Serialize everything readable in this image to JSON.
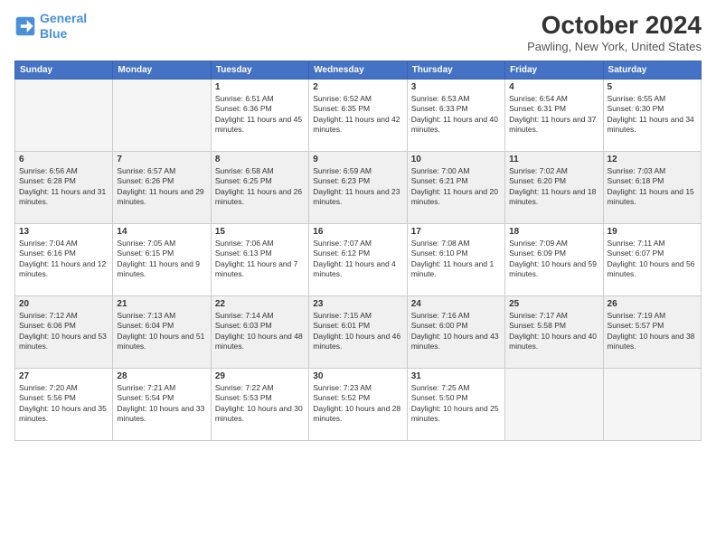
{
  "header": {
    "logo_line1": "General",
    "logo_line2": "Blue",
    "month_year": "October 2024",
    "location": "Pawling, New York, United States"
  },
  "weekdays": [
    "Sunday",
    "Monday",
    "Tuesday",
    "Wednesday",
    "Thursday",
    "Friday",
    "Saturday"
  ],
  "weeks": [
    [
      {
        "day": "",
        "info": ""
      },
      {
        "day": "",
        "info": ""
      },
      {
        "day": "1",
        "info": "Sunrise: 6:51 AM\nSunset: 6:36 PM\nDaylight: 11 hours and 45 minutes."
      },
      {
        "day": "2",
        "info": "Sunrise: 6:52 AM\nSunset: 6:35 PM\nDaylight: 11 hours and 42 minutes."
      },
      {
        "day": "3",
        "info": "Sunrise: 6:53 AM\nSunset: 6:33 PM\nDaylight: 11 hours and 40 minutes."
      },
      {
        "day": "4",
        "info": "Sunrise: 6:54 AM\nSunset: 6:31 PM\nDaylight: 11 hours and 37 minutes."
      },
      {
        "day": "5",
        "info": "Sunrise: 6:55 AM\nSunset: 6:30 PM\nDaylight: 11 hours and 34 minutes."
      }
    ],
    [
      {
        "day": "6",
        "info": "Sunrise: 6:56 AM\nSunset: 6:28 PM\nDaylight: 11 hours and 31 minutes."
      },
      {
        "day": "7",
        "info": "Sunrise: 6:57 AM\nSunset: 6:26 PM\nDaylight: 11 hours and 29 minutes."
      },
      {
        "day": "8",
        "info": "Sunrise: 6:58 AM\nSunset: 6:25 PM\nDaylight: 11 hours and 26 minutes."
      },
      {
        "day": "9",
        "info": "Sunrise: 6:59 AM\nSunset: 6:23 PM\nDaylight: 11 hours and 23 minutes."
      },
      {
        "day": "10",
        "info": "Sunrise: 7:00 AM\nSunset: 6:21 PM\nDaylight: 11 hours and 20 minutes."
      },
      {
        "day": "11",
        "info": "Sunrise: 7:02 AM\nSunset: 6:20 PM\nDaylight: 11 hours and 18 minutes."
      },
      {
        "day": "12",
        "info": "Sunrise: 7:03 AM\nSunset: 6:18 PM\nDaylight: 11 hours and 15 minutes."
      }
    ],
    [
      {
        "day": "13",
        "info": "Sunrise: 7:04 AM\nSunset: 6:16 PM\nDaylight: 11 hours and 12 minutes."
      },
      {
        "day": "14",
        "info": "Sunrise: 7:05 AM\nSunset: 6:15 PM\nDaylight: 11 hours and 9 minutes."
      },
      {
        "day": "15",
        "info": "Sunrise: 7:06 AM\nSunset: 6:13 PM\nDaylight: 11 hours and 7 minutes."
      },
      {
        "day": "16",
        "info": "Sunrise: 7:07 AM\nSunset: 6:12 PM\nDaylight: 11 hours and 4 minutes."
      },
      {
        "day": "17",
        "info": "Sunrise: 7:08 AM\nSunset: 6:10 PM\nDaylight: 11 hours and 1 minute."
      },
      {
        "day": "18",
        "info": "Sunrise: 7:09 AM\nSunset: 6:09 PM\nDaylight: 10 hours and 59 minutes."
      },
      {
        "day": "19",
        "info": "Sunrise: 7:11 AM\nSunset: 6:07 PM\nDaylight: 10 hours and 56 minutes."
      }
    ],
    [
      {
        "day": "20",
        "info": "Sunrise: 7:12 AM\nSunset: 6:06 PM\nDaylight: 10 hours and 53 minutes."
      },
      {
        "day": "21",
        "info": "Sunrise: 7:13 AM\nSunset: 6:04 PM\nDaylight: 10 hours and 51 minutes."
      },
      {
        "day": "22",
        "info": "Sunrise: 7:14 AM\nSunset: 6:03 PM\nDaylight: 10 hours and 48 minutes."
      },
      {
        "day": "23",
        "info": "Sunrise: 7:15 AM\nSunset: 6:01 PM\nDaylight: 10 hours and 46 minutes."
      },
      {
        "day": "24",
        "info": "Sunrise: 7:16 AM\nSunset: 6:00 PM\nDaylight: 10 hours and 43 minutes."
      },
      {
        "day": "25",
        "info": "Sunrise: 7:17 AM\nSunset: 5:58 PM\nDaylight: 10 hours and 40 minutes."
      },
      {
        "day": "26",
        "info": "Sunrise: 7:19 AM\nSunset: 5:57 PM\nDaylight: 10 hours and 38 minutes."
      }
    ],
    [
      {
        "day": "27",
        "info": "Sunrise: 7:20 AM\nSunset: 5:56 PM\nDaylight: 10 hours and 35 minutes."
      },
      {
        "day": "28",
        "info": "Sunrise: 7:21 AM\nSunset: 5:54 PM\nDaylight: 10 hours and 33 minutes."
      },
      {
        "day": "29",
        "info": "Sunrise: 7:22 AM\nSunset: 5:53 PM\nDaylight: 10 hours and 30 minutes."
      },
      {
        "day": "30",
        "info": "Sunrise: 7:23 AM\nSunset: 5:52 PM\nDaylight: 10 hours and 28 minutes."
      },
      {
        "day": "31",
        "info": "Sunrise: 7:25 AM\nSunset: 5:50 PM\nDaylight: 10 hours and 25 minutes."
      },
      {
        "day": "",
        "info": ""
      },
      {
        "day": "",
        "info": ""
      }
    ]
  ]
}
